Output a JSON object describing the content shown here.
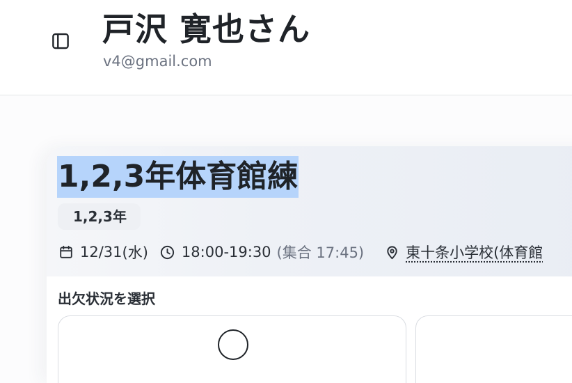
{
  "header": {
    "user_name": "戸沢 寛也さん",
    "user_email": "v4@gmail.com"
  },
  "event": {
    "title": "1,2,3年体育館練",
    "grade_tag": "1,2,3年",
    "date": "12/31",
    "weekday": "(水)",
    "time": "18:00-19:30",
    "gather_time": "(集合 17:45)",
    "location": "東十条小学校(体育館"
  },
  "attendance": {
    "label": "出欠状況を選択",
    "options": [
      {
        "symbol": "〇"
      },
      {
        "symbol": ""
      }
    ]
  },
  "colors": {
    "title_highlight": "#b6d4fb",
    "header_bg": "#ffffff",
    "card_header_gradient": [
      "#f5f6f9",
      "#e9edf4"
    ],
    "muted_text": "#6b7280"
  },
  "icons": {
    "sidebar_toggle": "sidebar-toggle-icon",
    "date": "calendar-icon",
    "time": "clock-icon",
    "location": "map-pin-icon",
    "attendance_option_1": "circle-icon"
  }
}
